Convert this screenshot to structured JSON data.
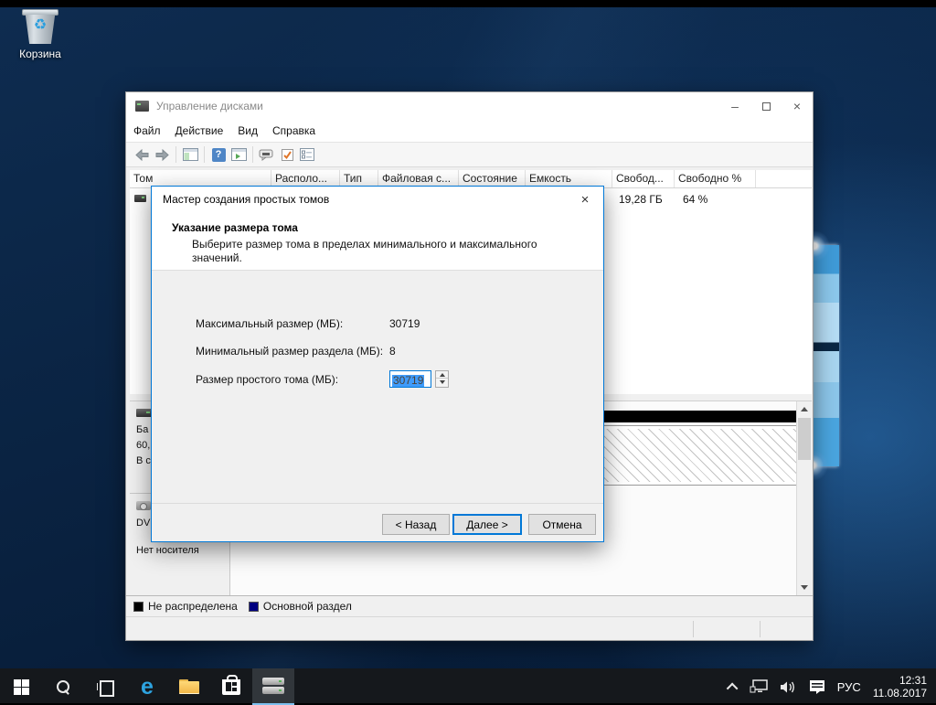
{
  "colors": {
    "accent": "#0078d7",
    "selection_highlight": "#3f9bfa",
    "unallocated": "#000000",
    "primary_partition": "#000080"
  },
  "desktop": {
    "recycle_bin_label": "Корзина"
  },
  "icons": {
    "recycle": "♻",
    "close": "×",
    "minimize": "–",
    "help": "?"
  },
  "dm_window": {
    "title": "Управление дисками",
    "menu": [
      "Файл",
      "Действие",
      "Вид",
      "Справка"
    ],
    "table": {
      "headers": [
        "Том",
        "Располо...",
        "Тип",
        "Файловая с...",
        "Состояние",
        "Емкость",
        "Свобод...",
        "Свободно %"
      ],
      "row": {
        "free_space": "19,28 ГБ",
        "free_percent": "64 %"
      }
    },
    "disk_panel": {
      "line1": "Ба",
      "line2": "60,",
      "line3": "В с",
      "cd_line": "DV",
      "no_media": "Нет носителя"
    },
    "legend": [
      {
        "label": "Не распределена",
        "color": "#000000"
      },
      {
        "label": "Основной раздел",
        "color": "#000080"
      }
    ]
  },
  "wizard": {
    "title": "Мастер создания простых томов",
    "heading": "Указание размера тома",
    "subtitle": "Выберите размер тома в пределах минимального и максимального значений.",
    "rows": [
      {
        "label": "Максимальный размер (МБ):",
        "value": "30719"
      },
      {
        "label": "Минимальный размер раздела (МБ):",
        "value": "8"
      },
      {
        "label": "Размер простого тома (МБ):",
        "value": "30719"
      }
    ],
    "buttons": {
      "back": "< Назад",
      "next": "Далее >",
      "cancel": "Отмена"
    }
  },
  "taskbar": {
    "language": "РУС",
    "clock": {
      "time": "12:31",
      "date": "11.08.2017"
    }
  }
}
